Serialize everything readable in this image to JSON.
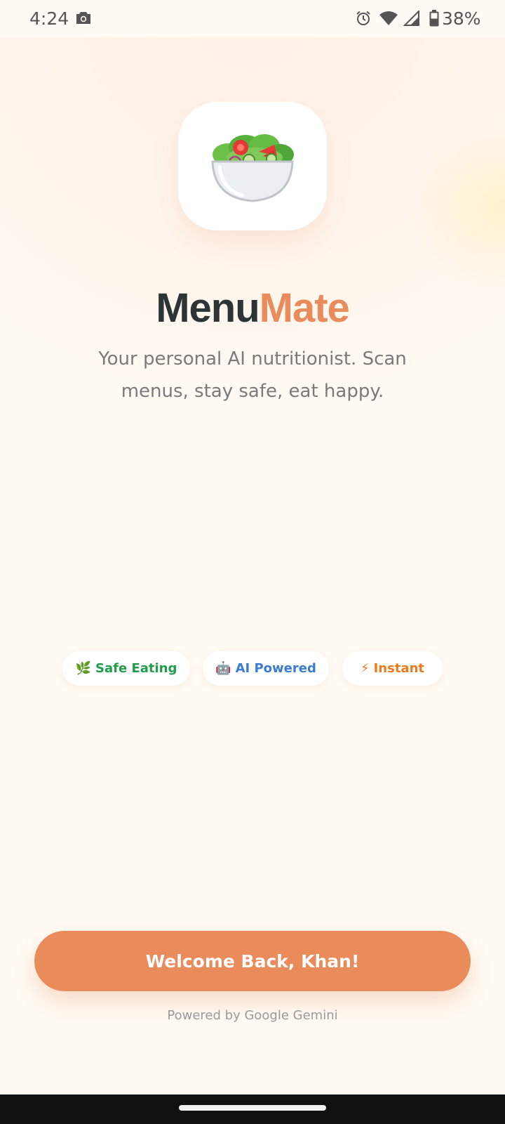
{
  "status_bar": {
    "time": "4:24",
    "battery_percent": "38%",
    "icons": [
      "camera-icon",
      "alarm-icon",
      "wifi-icon",
      "signal-icon",
      "battery-icon"
    ]
  },
  "app": {
    "icon": "salad-icon",
    "title_part1": "Menu",
    "title_part2": "Mate",
    "tagline": "Your personal AI nutritionist. Scan menus, stay safe, eat happy."
  },
  "features": [
    {
      "emoji": "🌿",
      "label": "Safe Eating",
      "color": "#1f9d4a"
    },
    {
      "emoji": "🤖",
      "label": "AI Powered",
      "color": "#3a7bd5"
    },
    {
      "emoji": "⚡",
      "label": "Instant",
      "color": "#ee7a1c"
    }
  ],
  "cta": {
    "label": "Welcome Back, Khan!",
    "color": "#e98b5b"
  },
  "footer": {
    "powered_by": "Powered by Google Gemini"
  },
  "colors": {
    "brand_dark": "#2c3435",
    "brand_accent": "#e98b5b",
    "background": "#fffaf3"
  }
}
